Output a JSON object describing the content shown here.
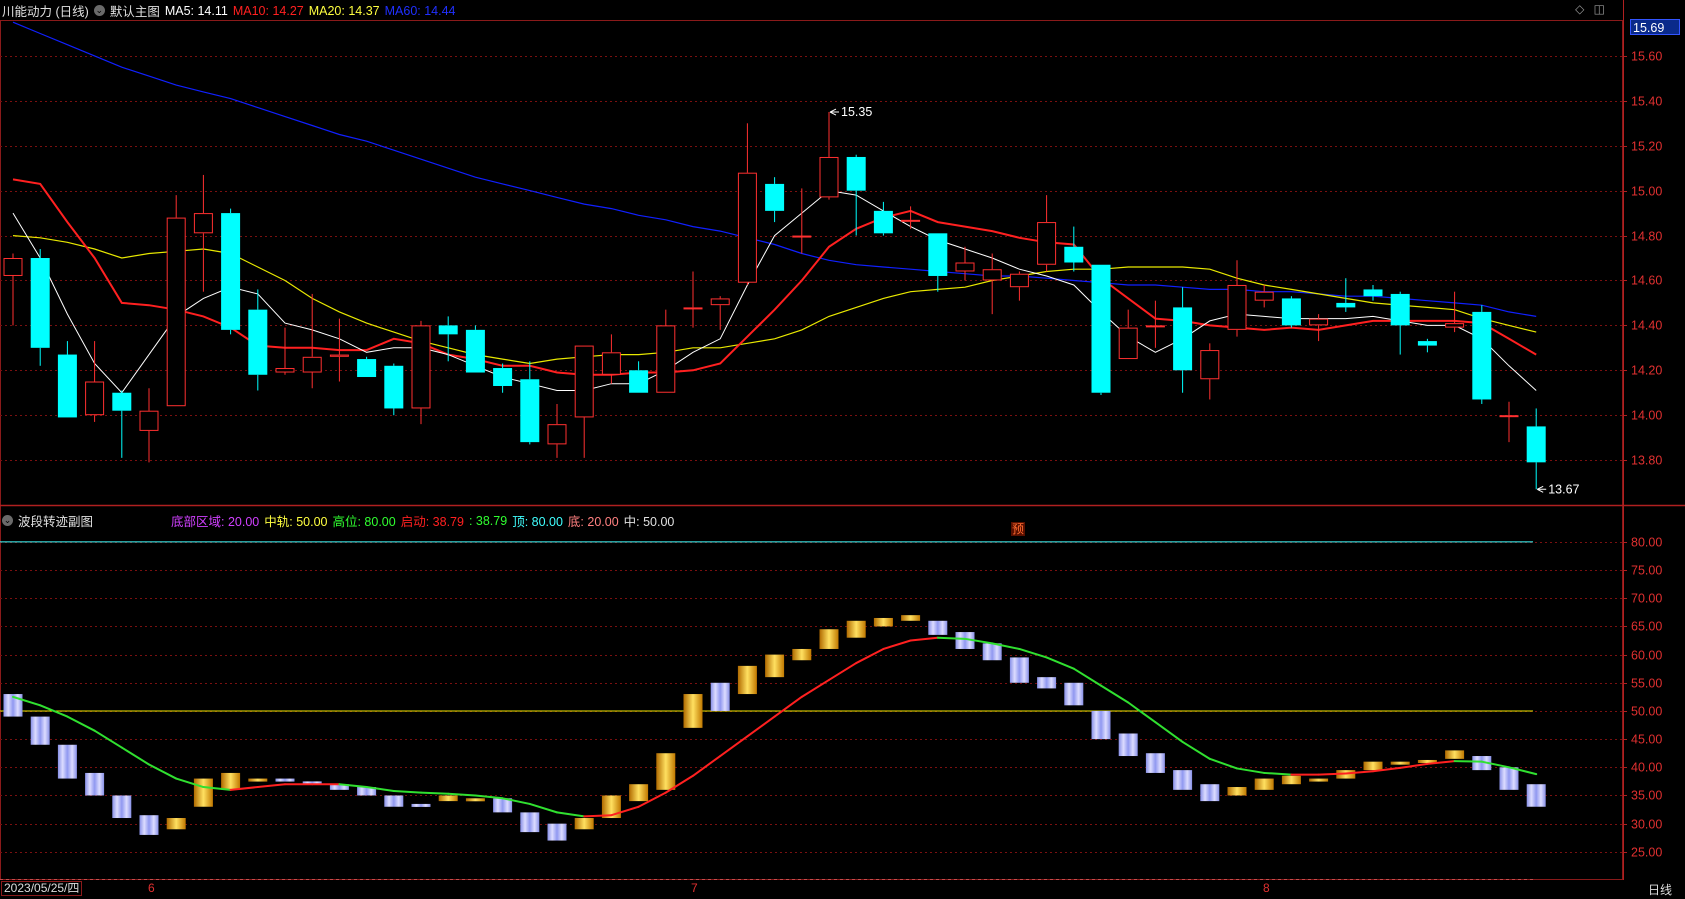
{
  "header": {
    "stock_name": "川能动力 (日线)",
    "chart_title": "默认主图",
    "ma_legend": [
      {
        "label": "MA5: 14.11",
        "color": "#ffffff"
      },
      {
        "label": "MA10: 14.27",
        "color": "#ff2020"
      },
      {
        "label": "MA20: 14.37",
        "color": "#ffff40"
      },
      {
        "label": "MA60: 14.44",
        "color": "#2030ff"
      }
    ],
    "current_price_tag": "15.69",
    "icons": [
      "diamond-icon",
      "window-icon"
    ]
  },
  "sub_header": {
    "title": "波段转迹副图",
    "legend": [
      {
        "label": "底部区域: 20.00",
        "color": "#d040ff"
      },
      {
        "label": "中轨: 50.00",
        "color": "#ffff40"
      },
      {
        "label": "高位: 80.00",
        "color": "#30ff30"
      },
      {
        "label": "启动: 38.79",
        "color": "#ff2020"
      },
      {
        "label": ": 38.79",
        "color": "#30ff30"
      },
      {
        "label": "顶: 80.00",
        "color": "#40ffff"
      },
      {
        "label": "底: 20.00",
        "color": "#ff8080"
      },
      {
        "label": "中: 50.00",
        "color": "#e0e0e0"
      }
    ],
    "marker_label": "预"
  },
  "footer": {
    "date": "2023/05/25/四",
    "period": "日线",
    "month_ticks": [
      {
        "label": "6",
        "index": 5
      },
      {
        "label": "7",
        "index": 26
      },
      {
        "label": "8",
        "index": 47
      }
    ]
  },
  "colors": {
    "up": "#ff3030",
    "down": "#00ffff",
    "ma5": "#ffffff",
    "ma10": "#ff2020",
    "ma20": "#e8e800",
    "ma60": "#1020ff",
    "grid": "#7a1010",
    "osc_up": "#ffb000",
    "osc_down": "#aab0ff",
    "osc_line_up": "#ff2020",
    "osc_line_down": "#30e030"
  },
  "chart_data": [
    {
      "type": "candlestick",
      "title": "川能动力 (日线)",
      "ylim": [
        13.6,
        15.76
      ],
      "y_ticks": [
        15.6,
        15.4,
        15.2,
        15.0,
        14.8,
        14.6,
        14.4,
        14.2,
        14.0,
        13.8
      ],
      "y_tick_labels": [
        "15.60",
        "15.40",
        "15.20",
        "15.00",
        "14.80",
        "14.60",
        "14.40",
        "14.20",
        "14.00",
        "13.80"
      ],
      "annotations": [
        {
          "text": "15.35",
          "index": 30,
          "value": 15.35
        },
        {
          "text": "13.67",
          "index": 56,
          "value": 13.67
        }
      ],
      "candles": [
        {
          "o": 14.62,
          "h": 14.72,
          "l": 14.4,
          "c": 14.7
        },
        {
          "o": 14.7,
          "h": 14.74,
          "l": 14.22,
          "c": 14.3
        },
        {
          "o": 14.27,
          "h": 14.33,
          "l": 13.99,
          "c": 13.99
        },
        {
          "o": 14.0,
          "h": 14.33,
          "l": 13.97,
          "c": 14.15
        },
        {
          "o": 14.1,
          "h": 14.11,
          "l": 13.81,
          "c": 14.02
        },
        {
          "o": 13.93,
          "h": 14.12,
          "l": 13.79,
          "c": 14.02
        },
        {
          "o": 14.04,
          "h": 14.98,
          "l": 14.04,
          "c": 14.88
        },
        {
          "o": 14.81,
          "h": 15.07,
          "l": 14.55,
          "c": 14.9
        },
        {
          "o": 14.9,
          "h": 14.92,
          "l": 14.36,
          "c": 14.38
        },
        {
          "o": 14.47,
          "h": 14.56,
          "l": 14.11,
          "c": 14.18
        },
        {
          "o": 14.19,
          "h": 14.39,
          "l": 14.18,
          "c": 14.21
        },
        {
          "o": 14.19,
          "h": 14.54,
          "l": 14.12,
          "c": 14.26
        },
        {
          "o": 14.26,
          "h": 14.43,
          "l": 14.15,
          "c": 14.27
        },
        {
          "o": 14.25,
          "h": 14.26,
          "l": 14.17,
          "c": 14.17
        },
        {
          "o": 14.22,
          "h": 14.23,
          "l": 14.0,
          "c": 14.03
        },
        {
          "o": 14.03,
          "h": 14.42,
          "l": 13.96,
          "c": 14.4
        },
        {
          "o": 14.4,
          "h": 14.44,
          "l": 14.24,
          "c": 14.36
        },
        {
          "o": 14.38,
          "h": 14.4,
          "l": 14.19,
          "c": 14.19
        },
        {
          "o": 14.21,
          "h": 14.23,
          "l": 14.1,
          "c": 14.13
        },
        {
          "o": 14.16,
          "h": 14.24,
          "l": 13.87,
          "c": 13.88
        },
        {
          "o": 13.87,
          "h": 14.05,
          "l": 13.81,
          "c": 13.96
        },
        {
          "o": 13.99,
          "h": 14.31,
          "l": 13.81,
          "c": 14.31
        },
        {
          "o": 14.18,
          "h": 14.36,
          "l": 14.14,
          "c": 14.28
        },
        {
          "o": 14.2,
          "h": 14.24,
          "l": 14.1,
          "c": 14.1
        },
        {
          "o": 14.1,
          "h": 14.47,
          "l": 14.1,
          "c": 14.4
        },
        {
          "o": 14.48,
          "h": 14.64,
          "l": 14.39,
          "c": 14.48
        },
        {
          "o": 14.49,
          "h": 14.53,
          "l": 14.38,
          "c": 14.52
        },
        {
          "o": 14.59,
          "h": 15.3,
          "l": 14.58,
          "c": 15.08
        },
        {
          "o": 15.03,
          "h": 15.06,
          "l": 14.86,
          "c": 14.91
        },
        {
          "o": 14.8,
          "h": 15.01,
          "l": 14.72,
          "c": 14.8
        },
        {
          "o": 14.97,
          "h": 15.35,
          "l": 14.96,
          "c": 15.15
        },
        {
          "o": 15.15,
          "h": 15.16,
          "l": 14.8,
          "c": 15.0
        },
        {
          "o": 14.91,
          "h": 14.95,
          "l": 14.8,
          "c": 14.81
        },
        {
          "o": 14.87,
          "h": 14.93,
          "l": 14.83,
          "c": 14.87
        },
        {
          "o": 14.81,
          "h": 14.81,
          "l": 14.55,
          "c": 14.62
        },
        {
          "o": 14.64,
          "h": 14.75,
          "l": 14.6,
          "c": 14.68
        },
        {
          "o": 14.6,
          "h": 14.72,
          "l": 14.45,
          "c": 14.65
        },
        {
          "o": 14.57,
          "h": 14.64,
          "l": 14.51,
          "c": 14.63
        },
        {
          "o": 14.67,
          "h": 14.98,
          "l": 14.64,
          "c": 14.86
        },
        {
          "o": 14.75,
          "h": 14.84,
          "l": 14.64,
          "c": 14.68
        },
        {
          "o": 14.67,
          "h": 14.67,
          "l": 14.09,
          "c": 14.1
        },
        {
          "o": 14.25,
          "h": 14.47,
          "l": 14.25,
          "c": 14.39
        },
        {
          "o": 14.4,
          "h": 14.51,
          "l": 14.3,
          "c": 14.4
        },
        {
          "o": 14.48,
          "h": 14.57,
          "l": 14.1,
          "c": 14.2
        },
        {
          "o": 14.16,
          "h": 14.32,
          "l": 14.07,
          "c": 14.29
        },
        {
          "o": 14.38,
          "h": 14.69,
          "l": 14.35,
          "c": 14.58
        },
        {
          "o": 14.51,
          "h": 14.58,
          "l": 14.48,
          "c": 14.55
        },
        {
          "o": 14.52,
          "h": 14.53,
          "l": 14.39,
          "c": 14.4
        },
        {
          "o": 14.4,
          "h": 14.45,
          "l": 14.33,
          "c": 14.43
        },
        {
          "o": 14.5,
          "h": 14.61,
          "l": 14.46,
          "c": 14.48
        },
        {
          "o": 14.56,
          "h": 14.58,
          "l": 14.51,
          "c": 14.53
        },
        {
          "o": 14.54,
          "h": 14.55,
          "l": 14.27,
          "c": 14.4
        },
        {
          "o": 14.33,
          "h": 14.34,
          "l": 14.28,
          "c": 14.31
        },
        {
          "o": 14.39,
          "h": 14.55,
          "l": 14.37,
          "c": 14.41
        },
        {
          "o": 14.46,
          "h": 14.49,
          "l": 14.05,
          "c": 14.07
        },
        {
          "o": 14.0,
          "h": 14.06,
          "l": 13.88,
          "c": 14.0
        },
        {
          "o": 13.95,
          "h": 14.03,
          "l": 13.67,
          "c": 13.79
        }
      ],
      "ma5": [
        14.9,
        14.7,
        14.45,
        14.23,
        14.1,
        14.27,
        14.44,
        14.52,
        14.57,
        14.54,
        14.41,
        14.38,
        14.34,
        14.28,
        14.3,
        14.3,
        14.27,
        14.22,
        14.17,
        14.14,
        14.11,
        14.11,
        14.14,
        14.14,
        14.2,
        14.28,
        14.34,
        14.58,
        14.8,
        14.9,
        15.0,
        14.98,
        14.91,
        14.84,
        14.78,
        14.74,
        14.7,
        14.65,
        14.62,
        14.58,
        14.46,
        14.35,
        14.28,
        14.34,
        14.42,
        14.45,
        14.44,
        14.43,
        14.43,
        14.43,
        14.44,
        14.42,
        14.4,
        14.4,
        14.34,
        14.22,
        14.11
      ],
      "ma10": [
        15.05,
        15.03,
        14.86,
        14.7,
        14.5,
        14.49,
        14.47,
        14.44,
        14.39,
        14.31,
        14.3,
        14.3,
        14.29,
        14.29,
        14.34,
        14.32,
        14.27,
        14.25,
        14.22,
        14.22,
        14.19,
        14.18,
        14.18,
        14.19,
        14.19,
        14.2,
        14.23,
        14.35,
        14.47,
        14.6,
        14.75,
        14.83,
        14.88,
        14.91,
        14.86,
        14.84,
        14.82,
        14.79,
        14.77,
        14.76,
        14.61,
        14.52,
        14.43,
        14.42,
        14.4,
        14.39,
        14.38,
        14.39,
        14.38,
        14.4,
        14.42,
        14.42,
        14.42,
        14.42,
        14.41,
        14.34,
        14.27
      ],
      "ma20": [
        14.8,
        14.79,
        14.77,
        14.74,
        14.7,
        14.72,
        14.73,
        14.74,
        14.72,
        14.66,
        14.6,
        14.52,
        14.46,
        14.41,
        14.37,
        14.33,
        14.3,
        14.27,
        14.25,
        14.23,
        14.25,
        14.26,
        14.27,
        14.27,
        14.28,
        14.3,
        14.3,
        14.32,
        14.34,
        14.38,
        14.44,
        14.48,
        14.52,
        14.55,
        14.56,
        14.57,
        14.6,
        14.62,
        14.64,
        14.65,
        14.65,
        14.66,
        14.66,
        14.66,
        14.65,
        14.61,
        14.58,
        14.56,
        14.54,
        14.52,
        14.5,
        14.49,
        14.48,
        14.47,
        14.43,
        14.4,
        14.37
      ],
      "ma60": [
        15.75,
        15.7,
        15.65,
        15.6,
        15.55,
        15.51,
        15.47,
        15.44,
        15.41,
        15.37,
        15.33,
        15.29,
        15.25,
        15.22,
        15.18,
        15.14,
        15.1,
        15.06,
        15.03,
        15.0,
        14.97,
        14.94,
        14.92,
        14.89,
        14.87,
        14.84,
        14.82,
        14.79,
        14.76,
        14.72,
        14.69,
        14.67,
        14.66,
        14.65,
        14.64,
        14.63,
        14.62,
        14.62,
        14.61,
        14.6,
        14.59,
        14.58,
        14.58,
        14.57,
        14.56,
        14.56,
        14.55,
        14.55,
        14.54,
        14.53,
        14.53,
        14.52,
        14.51,
        14.5,
        14.49,
        14.46,
        14.44
      ]
    },
    {
      "type": "bar",
      "title": "波段转迹副图",
      "ylim": [
        20,
        83
      ],
      "y_ticks": [
        80,
        75,
        70,
        65,
        60,
        55,
        50,
        45,
        40,
        35,
        30,
        25
      ],
      "y_tick_labels": [
        "80.00",
        "75.00",
        "70.00",
        "65.00",
        "60.00",
        "55.00",
        "50.00",
        "45.00",
        "40.00",
        "35.00",
        "30.00",
        "25.00"
      ],
      "reference_lines": [
        {
          "name": "顶",
          "value": 80,
          "color": "#40ffff"
        },
        {
          "name": "中",
          "value": 50,
          "color": "#e8e800"
        },
        {
          "name": "底",
          "value": 20,
          "color": "#ff8080"
        }
      ],
      "bars": [
        {
          "from": 53,
          "to": 49
        },
        {
          "from": 49,
          "to": 44
        },
        {
          "from": 44,
          "to": 38
        },
        {
          "from": 39,
          "to": 35
        },
        {
          "from": 35,
          "to": 31
        },
        {
          "from": 31.5,
          "to": 28
        },
        {
          "from": 29,
          "to": 31
        },
        {
          "from": 33,
          "to": 38
        },
        {
          "from": 36,
          "to": 39
        },
        {
          "from": 37.5,
          "to": 38
        },
        {
          "from": 38,
          "to": 37.5
        },
        {
          "from": 37.5,
          "to": 37
        },
        {
          "from": 37,
          "to": 36
        },
        {
          "from": 36.5,
          "to": 35
        },
        {
          "from": 35,
          "to": 33
        },
        {
          "from": 33.5,
          "to": 33
        },
        {
          "from": 34,
          "to": 35
        },
        {
          "from": 34,
          "to": 34.5
        },
        {
          "from": 34.5,
          "to": 32
        },
        {
          "from": 32,
          "to": 28.5
        },
        {
          "from": 30,
          "to": 27
        },
        {
          "from": 29,
          "to": 31
        },
        {
          "from": 31,
          "to": 35
        },
        {
          "from": 34,
          "to": 37
        },
        {
          "from": 36,
          "to": 42.5
        },
        {
          "from": 47,
          "to": 53
        },
        {
          "from": 55,
          "to": 50
        },
        {
          "from": 53,
          "to": 58
        },
        {
          "from": 56,
          "to": 60
        },
        {
          "from": 59,
          "to": 61
        },
        {
          "from": 61,
          "to": 64.5
        },
        {
          "from": 63,
          "to": 66
        },
        {
          "from": 65,
          "to": 66.5
        },
        {
          "from": 66,
          "to": 67
        },
        {
          "from": 66,
          "to": 63.5
        },
        {
          "from": 64,
          "to": 61
        },
        {
          "from": 62,
          "to": 59
        },
        {
          "from": 59.5,
          "to": 55
        },
        {
          "from": 56,
          "to": 54
        },
        {
          "from": 55,
          "to": 51
        },
        {
          "from": 50,
          "to": 45
        },
        {
          "from": 46,
          "to": 42
        },
        {
          "from": 42.5,
          "to": 39
        },
        {
          "from": 39.5,
          "to": 36
        },
        {
          "from": 37,
          "to": 34
        },
        {
          "from": 35,
          "to": 36.5
        },
        {
          "from": 36,
          "to": 38
        },
        {
          "from": 37,
          "to": 38.5
        },
        {
          "from": 37.5,
          "to": 38
        },
        {
          "from": 38,
          "to": 39.5
        },
        {
          "from": 39.5,
          "to": 41
        },
        {
          "from": 40.5,
          "to": 41
        },
        {
          "from": 40.8,
          "to": 41.3
        },
        {
          "from": 41.5,
          "to": 43
        },
        {
          "from": 42,
          "to": 39.5
        },
        {
          "from": 40,
          "to": 36
        },
        {
          "from": 37,
          "to": 33
        }
      ],
      "line": [
        52.5,
        51,
        49,
        46.5,
        43.5,
        40.5,
        38,
        36.5,
        36,
        36.5,
        37,
        37,
        37,
        36.5,
        35.8,
        35.5,
        35.3,
        35.0,
        34.5,
        33.5,
        32,
        31.3,
        31.5,
        33,
        35.5,
        38.5,
        42,
        45.5,
        49,
        52.5,
        55.5,
        58.5,
        61,
        62.5,
        63,
        62.8,
        62,
        61,
        59.5,
        57.5,
        54.5,
        51.5,
        48,
        44.5,
        41.5,
        39.8,
        39,
        38.7,
        38.7,
        38.9,
        39.3,
        39.9,
        40.6,
        41.1,
        41,
        40,
        38.79
      ]
    }
  ]
}
